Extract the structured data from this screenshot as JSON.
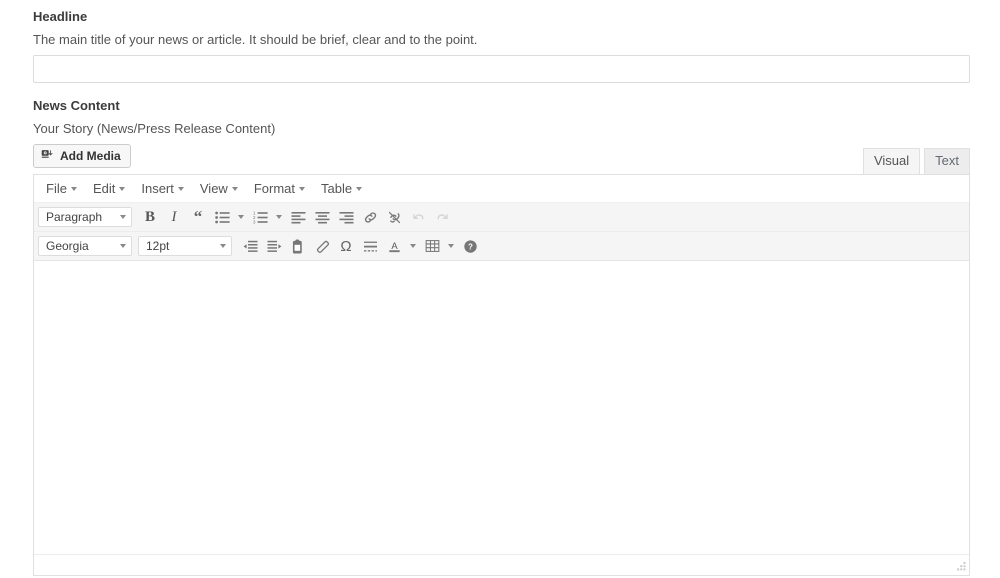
{
  "headline_field": {
    "label": "Headline",
    "description": "The main title of your news or article. It should be brief, clear and to the point.",
    "value": "",
    "placeholder": ""
  },
  "content_field": {
    "label": "News Content",
    "description": "Your Story (News/Press Release Content)"
  },
  "media": {
    "add_media_label": "Add Media",
    "icon": "add-media-icon"
  },
  "editor_tabs": {
    "visual": "Visual",
    "text": "Text",
    "active": "Visual"
  },
  "menubar": [
    {
      "label": "File"
    },
    {
      "label": "Edit"
    },
    {
      "label": "Insert"
    },
    {
      "label": "View"
    },
    {
      "label": "Format"
    },
    {
      "label": "Table"
    }
  ],
  "toolbar_row1": {
    "block_format": "Paragraph",
    "buttons": [
      {
        "name": "bold-icon",
        "title": "Bold",
        "glyph": "B"
      },
      {
        "name": "italic-icon",
        "title": "Italic",
        "glyph": "I"
      },
      {
        "name": "blockquote-icon",
        "title": "Blockquote",
        "glyph": "“"
      },
      {
        "name": "bulleted-list-icon",
        "title": "Bulleted list"
      },
      {
        "name": "numbered-list-icon",
        "title": "Numbered list"
      },
      {
        "name": "align-left-icon",
        "title": "Align left"
      },
      {
        "name": "align-center-icon",
        "title": "Align center"
      },
      {
        "name": "align-right-icon",
        "title": "Align right"
      },
      {
        "name": "link-icon",
        "title": "Insert/edit link"
      },
      {
        "name": "unlink-icon",
        "title": "Remove link"
      },
      {
        "name": "undo-icon",
        "title": "Undo",
        "disabled": true
      },
      {
        "name": "redo-icon",
        "title": "Redo",
        "disabled": true
      }
    ]
  },
  "toolbar_row2": {
    "font_family": "Georgia",
    "font_size": "12pt",
    "buttons": [
      {
        "name": "decrease-indent-icon",
        "title": "Decrease indent"
      },
      {
        "name": "increase-indent-icon",
        "title": "Increase indent"
      },
      {
        "name": "paste-as-text-icon",
        "title": "Paste as text"
      },
      {
        "name": "clear-formatting-icon",
        "title": "Clear formatting"
      },
      {
        "name": "special-character-icon",
        "title": "Special character",
        "glyph": "Ω"
      },
      {
        "name": "horizontal-rule-icon",
        "title": "Horizontal line"
      },
      {
        "name": "text-color-icon",
        "title": "Text color",
        "glyph": "A"
      },
      {
        "name": "table-icon",
        "title": "Table"
      },
      {
        "name": "help-icon",
        "title": "Keyboard shortcuts"
      }
    ]
  },
  "editor_body": {
    "content": ""
  },
  "colors": {
    "toolbar_bg": "#f5f5f5",
    "border": "#e0e0e0",
    "label_text": "#3c3c3c",
    "desc_text": "#555555",
    "icon": "#777777",
    "icon_disabled": "#cccccc"
  }
}
